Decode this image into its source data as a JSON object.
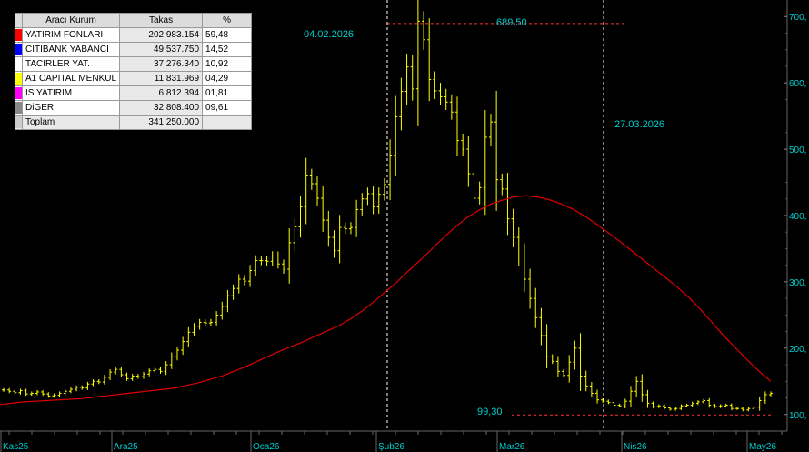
{
  "table": {
    "headers": [
      "Aracı Kurum",
      "Takas",
      "%"
    ],
    "rows": [
      {
        "name": "YATIRIM FONLARI",
        "takas": "202.983.154",
        "pct": "59,48",
        "color": "#ff0000"
      },
      {
        "name": "CITIBANK YABANCI",
        "takas": "49.537.750",
        "pct": "14,52",
        "color": "#0000ff"
      },
      {
        "name": "TACIRLER YAT.",
        "takas": "37.276.340",
        "pct": "10,92",
        "color": "#ffffff"
      },
      {
        "name": "A1 CAPITAL MENKUL",
        "takas": "11.831.969",
        "pct": "04,29",
        "color": "#ffff00"
      },
      {
        "name": "IS YATIRIM",
        "takas": "6.812.394",
        "pct": "01,81",
        "color": "#ff00ff"
      },
      {
        "name": "DiGER",
        "takas": "32.808.400",
        "pct": "09,61",
        "color": "#888888"
      }
    ],
    "total": {
      "name": "Toplam",
      "takas": "341.250.000",
      "pct": "",
      "color": "#cccccc"
    }
  },
  "chart_data": {
    "type": "line",
    "x_ticks": [
      "Kas25",
      "Ara25",
      "Oca26",
      "Şub26",
      "Mar26",
      "Nis26",
      "May26"
    ],
    "y_ticks": [
      100,
      200,
      300,
      400,
      500,
      600,
      700
    ],
    "y_tick_labels": [
      "100,",
      "200,",
      "300,",
      "400,",
      "500,",
      "600,",
      "700,"
    ],
    "ylim": [
      75,
      725
    ],
    "series": [
      {
        "role": "price",
        "color": "#ffff00",
        "values": [
          137,
          135,
          133,
          136,
          131,
          132,
          134,
          131,
          128,
          129,
          132,
          135,
          138,
          141,
          140,
          146,
          150,
          149,
          156,
          164,
          168,
          160,
          154,
          158,
          157,
          161,
          166,
          168,
          165,
          175,
          187,
          197,
          210,
          224,
          233,
          239,
          238,
          239,
          250,
          263,
          279,
          290,
          304,
          301,
          317,
          332,
          332,
          331,
          339,
          327,
          319,
          359,
          383,
          413,
          461,
          448,
          426,
          393,
          367,
          347,
          382,
          380,
          382,
          409,
          425,
          433,
          413,
          432,
          447,
          491,
          549,
          587,
          624,
          591,
          693,
          665,
          605,
          588,
          579,
          571,
          556,
          513,
          500,
          463,
          426,
          442,
          518,
          541,
          454,
          440,
          395,
          367,
          339,
          304,
          275,
          246,
          219,
          187,
          180,
          165,
          159,
          179,
          200,
          158,
          143,
          132,
          122,
          120,
          118,
          114,
          113,
          120,
          135,
          150,
          130,
          117,
          112,
          113,
          110,
          108,
          109,
          113,
          114,
          117,
          119,
          121,
          114,
          112,
          113,
          114,
          109,
          109,
          107,
          109,
          111,
          121,
          130,
          132
        ]
      },
      {
        "role": "moving-average",
        "color": "#dd0000",
        "values": [
          115,
          117,
          119,
          120,
          121,
          122,
          123,
          124,
          126,
          128,
          130,
          132,
          134,
          136,
          138,
          140,
          144,
          148,
          153,
          158,
          165,
          172,
          180,
          188,
          196,
          203,
          210,
          218,
          226,
          234,
          244,
          256,
          270,
          285,
          300,
          317,
          333,
          350,
          367,
          383,
          397,
          408,
          417,
          423,
          428,
          430,
          428,
          424,
          418,
          410,
          400,
          388,
          375,
          362,
          348,
          334,
          320,
          306,
          292,
          276,
          258,
          238,
          218,
          200,
          182,
          165,
          150
        ]
      }
    ],
    "annotations": [
      {
        "label": "04.02.2026",
        "color": "#00cccc"
      },
      {
        "label": "689,50",
        "color": "#00cccc"
      },
      {
        "label": "27.03.2026",
        "color": "#00cccc"
      },
      {
        "label": "99,30",
        "color": "#00cccc"
      }
    ],
    "reference_lines": [
      {
        "type": "horizontal",
        "value": 689.5,
        "color": "#ff3333"
      },
      {
        "type": "horizontal",
        "value": 99.3,
        "color": "#ff3333"
      },
      {
        "type": "vertical",
        "at": "04.02.2026",
        "color": "#ffffff"
      },
      {
        "type": "vertical",
        "at": "27.03.2026",
        "color": "#ffffff"
      }
    ]
  }
}
